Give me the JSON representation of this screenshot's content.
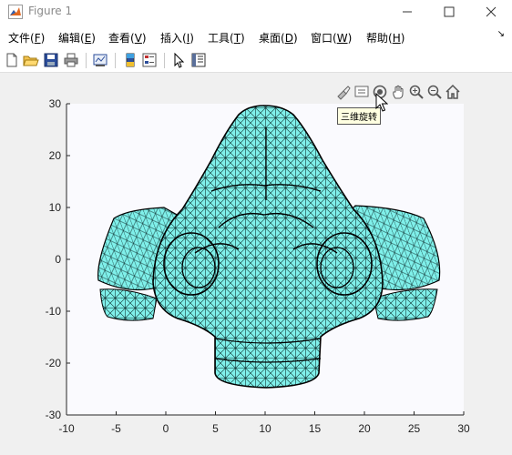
{
  "window": {
    "title": "Figure 1",
    "accent": "#1f4e9a"
  },
  "menu": {
    "items": [
      {
        "label": "文件(",
        "key": "F",
        "suffix": ")"
      },
      {
        "label": "编辑(",
        "key": "E",
        "suffix": ")"
      },
      {
        "label": "查看(",
        "key": "V",
        "suffix": ")"
      },
      {
        "label": "插入(",
        "key": "I",
        "suffix": ")"
      },
      {
        "label": "工具(",
        "key": "T",
        "suffix": ")"
      },
      {
        "label": "桌面(",
        "key": "D",
        "suffix": ")"
      },
      {
        "label": "窗口(",
        "key": "W",
        "suffix": ")"
      },
      {
        "label": "帮助(",
        "key": "H",
        "suffix": ")"
      }
    ],
    "overflow_glyph": "↘"
  },
  "toolbar": {
    "icons": [
      "new-figure-icon",
      "open-file-icon",
      "save-icon",
      "print-icon",
      "link-plot-icon",
      "insert-colorbar-icon",
      "insert-legend-icon",
      "pointer-icon",
      "property-inspector-icon"
    ]
  },
  "axes_toolbar": {
    "icons": [
      "brush-icon",
      "data-tips-icon",
      "rotate-3d-icon",
      "pan-icon",
      "zoom-in-icon",
      "zoom-out-icon",
      "home-icon"
    ],
    "tooltip": "三维旋转"
  },
  "plot": {
    "x_ticks": [
      "-10",
      "-5",
      "0",
      "5",
      "10",
      "15",
      "20",
      "25",
      "30"
    ],
    "y_ticks": [
      "30",
      "20",
      "10",
      "0",
      "-10",
      "-20",
      "-30"
    ],
    "x_range": [
      -10,
      30
    ],
    "y_range": [
      -30,
      30
    ],
    "face_color": "#7ff0ea",
    "edge_color": "#000000",
    "axes_background": "#fafafe"
  }
}
